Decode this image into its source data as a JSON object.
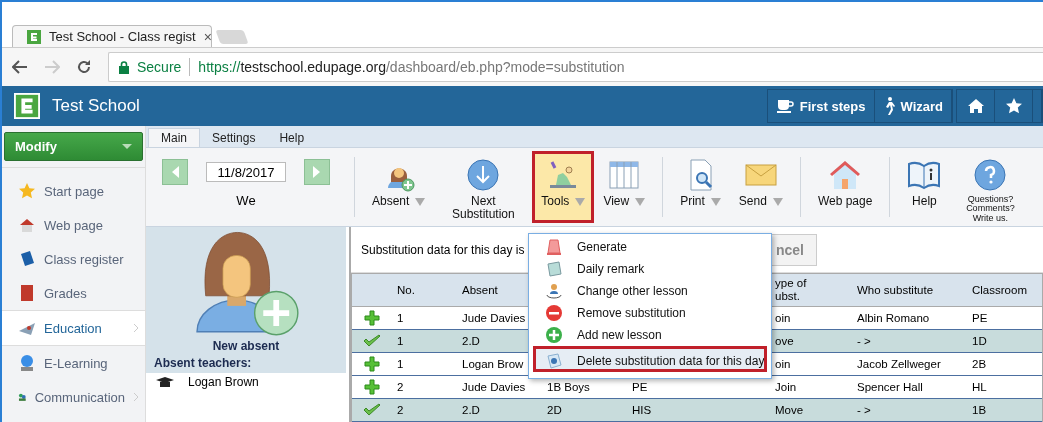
{
  "browser": {
    "tab_title": "Test School - Class regist",
    "tab_close": "×",
    "secure_label": "Secure",
    "url": {
      "scheme": "https://",
      "host": "testschool.edupage.org",
      "path": "/dashboard/eb.php?mode=substitution"
    }
  },
  "header": {
    "school": "Test School",
    "buttons": [
      {
        "label": "First steps"
      },
      {
        "label": "Wizard"
      }
    ]
  },
  "sidebar": {
    "modify": "Modify",
    "items": [
      {
        "label": "Start page",
        "selected": false,
        "submenu": false
      },
      {
        "label": "Web page",
        "selected": false,
        "submenu": false
      },
      {
        "label": "Class register",
        "selected": false,
        "submenu": false
      },
      {
        "label": "Grades",
        "selected": false,
        "submenu": false
      },
      {
        "label": "Education",
        "selected": true,
        "submenu": true
      },
      {
        "label": "E-Learning",
        "selected": false,
        "submenu": false
      },
      {
        "label": "Communication",
        "selected": false,
        "submenu": true
      }
    ]
  },
  "ribbon_tabs": [
    {
      "label": "Main",
      "selected": true
    },
    {
      "label": "Settings",
      "selected": false
    },
    {
      "label": "Help",
      "selected": false
    }
  ],
  "date_nav": {
    "date": "11/8/2017",
    "weekday": "We"
  },
  "ribbon": [
    {
      "label": "Absent",
      "dropdown": true,
      "selected": false,
      "annotated": false
    },
    {
      "label": "Next Substitution",
      "dropdown": false,
      "selected": false,
      "annotated": false
    },
    {
      "label": "Tools",
      "dropdown": true,
      "selected": true,
      "annotated": true
    },
    {
      "label": "View",
      "dropdown": true,
      "selected": false,
      "annotated": false
    },
    {
      "label": "Print",
      "dropdown": true,
      "selected": false,
      "annotated": false
    },
    {
      "label": "Send",
      "dropdown": true,
      "selected": false,
      "annotated": false
    },
    {
      "label": "Web page",
      "dropdown": false,
      "selected": false,
      "annotated": false
    },
    {
      "label": "Help",
      "dropdown": false,
      "selected": false,
      "annotated": false
    },
    {
      "label": "Questions? Comments? Write us.",
      "dropdown": false,
      "selected": false,
      "annotated": false
    }
  ],
  "absent_panel": {
    "new_absent": "New absent",
    "heading": "Absent teachers:",
    "teachers": [
      "Logan Brown"
    ]
  },
  "notice": "Substitution data for this day is",
  "cancel_button": "ncel",
  "table": {
    "columns": {
      "no": "No.",
      "absent": "Absent",
      "type": "ype of ubst.",
      "substitute": "Who substitute",
      "classroom": "Classroom"
    },
    "rows": [
      {
        "kind": "add",
        "no": "1",
        "absent": "Jude Davies",
        "type": "oin",
        "substitute": "Albin Romano",
        "classroom": "PE"
      },
      {
        "kind": "move",
        "no": "1",
        "absent": "2.D",
        "type": "ove",
        "substitute": "- >",
        "classroom": "1D"
      },
      {
        "kind": "add",
        "no": "1",
        "absent": "Logan Brow",
        "type": "oin",
        "substitute": "Jacob Zellweger",
        "classroom": "2B"
      },
      {
        "kind": "add",
        "no": "2",
        "absent": "Jude Davies",
        "class": "1B Boys",
        "subject": "PE",
        "type": "Join",
        "substitute": "Spencer Hall",
        "classroom": "HL"
      },
      {
        "kind": "move",
        "no": "2",
        "absent": "2.D",
        "class": "2D",
        "subject": "HIS",
        "type": "Move",
        "substitute": "- >",
        "classroom": "1B"
      }
    ]
  },
  "tools_menu": [
    {
      "label": "Generate",
      "annotated": false,
      "separator_before": false
    },
    {
      "label": "Daily remark",
      "annotated": false,
      "separator_before": false
    },
    {
      "label": "Change other lesson",
      "annotated": false,
      "separator_before": false
    },
    {
      "label": "Remove substitution",
      "annotated": false,
      "separator_before": false
    },
    {
      "label": "Add new lesson",
      "annotated": false,
      "separator_before": false
    },
    {
      "label": "Delete substitution data for this day",
      "annotated": true,
      "separator_before": true
    }
  ]
}
